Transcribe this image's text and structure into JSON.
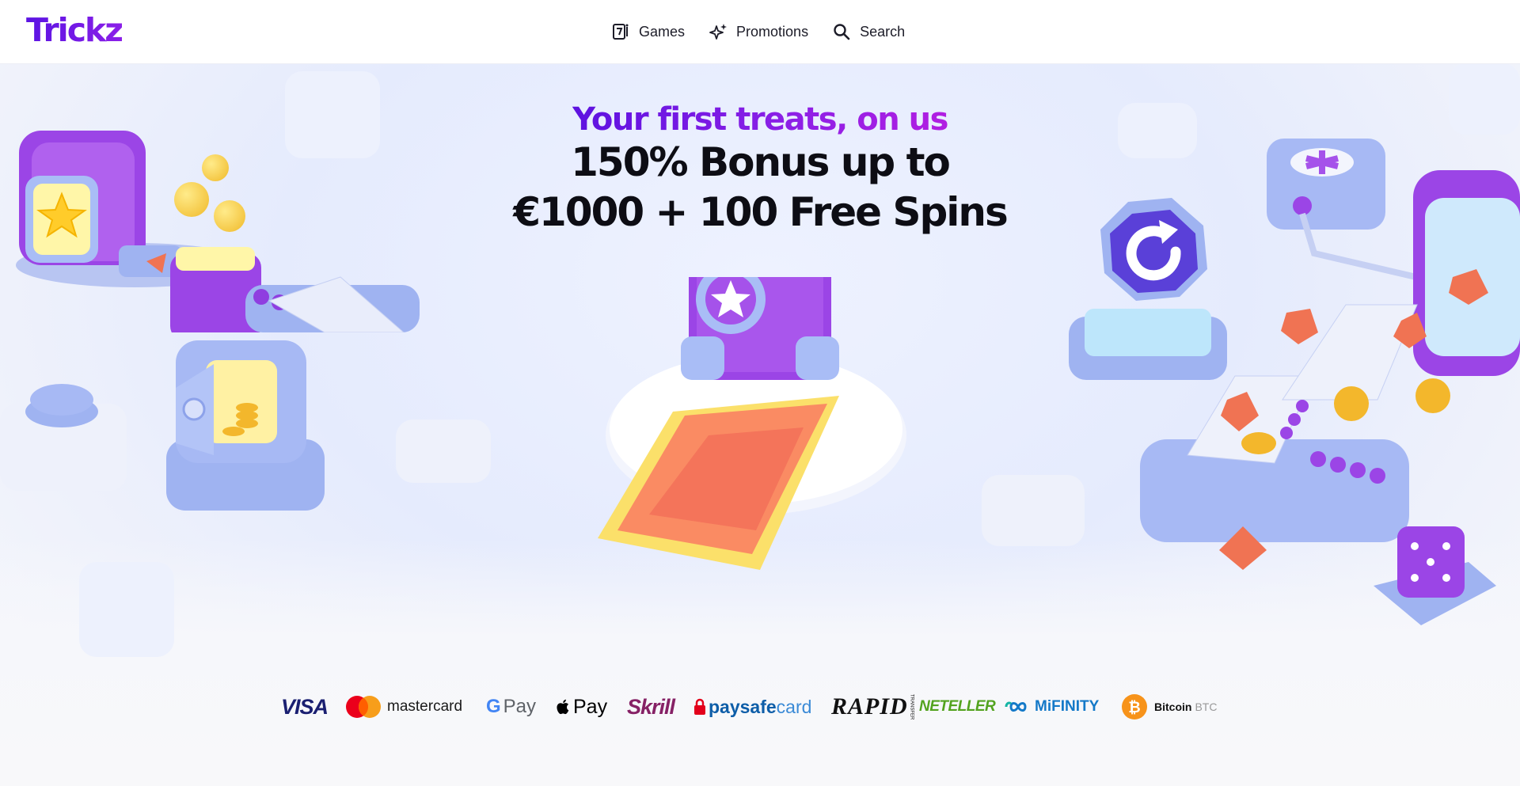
{
  "brand": {
    "logo": "Trickz",
    "accent": "#6a17e6"
  },
  "nav": {
    "items": [
      {
        "label": "Games",
        "icon": "games-icon"
      },
      {
        "label": "Promotions",
        "icon": "sparkles-icon"
      },
      {
        "label": "Search",
        "icon": "search-icon"
      }
    ]
  },
  "hero": {
    "tagline": "Your first treats, on us",
    "line1": "150% Bonus up to",
    "line2": "€1000 + 100 Free Spins"
  },
  "payments": {
    "visa": "VISA",
    "mastercard": "mastercard",
    "gpay": "Pay",
    "gpay_g": "G",
    "apple_pay": "Pay",
    "skrill": "Skrill",
    "paysafecard_a": "paysafe",
    "paysafecard_b": "card",
    "rapid": "RAPID",
    "rapid_sub": "TRANSFER",
    "neteller": "NETELLER",
    "mifinity": "MiFINITY",
    "bitcoin": "Bitcoin",
    "bitcoin_code": "BTC"
  }
}
